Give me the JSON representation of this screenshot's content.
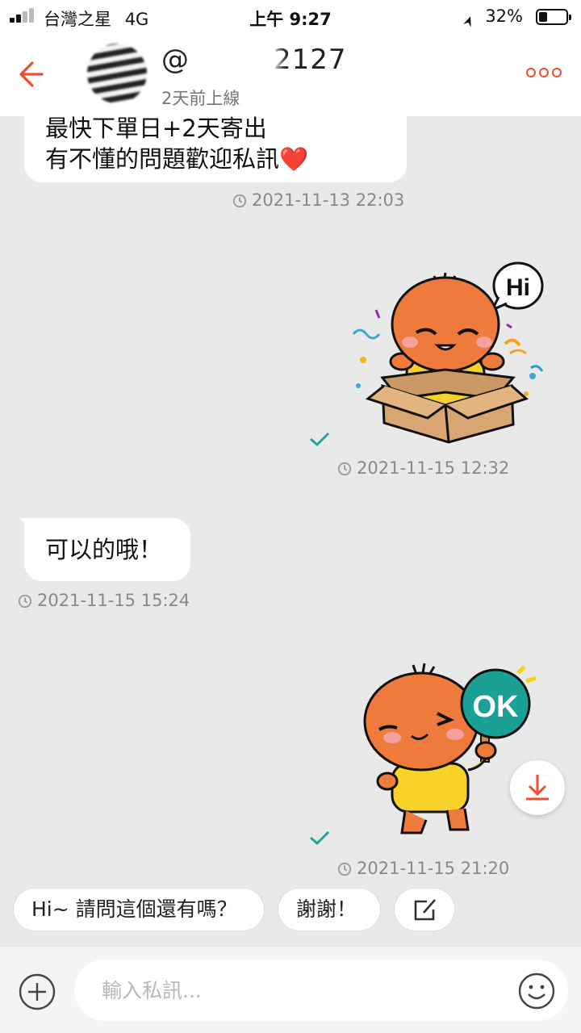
{
  "status_bar": {
    "carrier": "台灣之星",
    "network": "4G",
    "time": "上午 9:27",
    "battery": "32%",
    "location_icon": "location-arrow-icon"
  },
  "header": {
    "username": "@",
    "username_tail": "2127",
    "last_seen": "2天前上線",
    "back_icon": "back-arrow-icon",
    "more_icon": "more-dots-icon",
    "accent_color": "#ee4d2d"
  },
  "messages": [
    {
      "side": "incoming",
      "lines": [
        "最快下單日+2天寄出",
        "有不懂的問題歡迎私訊❤️"
      ],
      "timestamp": "2021-11-13 22:03"
    },
    {
      "side": "outgoing",
      "type": "sticker",
      "sticker": "Hi",
      "timestamp": "2021-11-15 12:32",
      "read": true
    },
    {
      "side": "incoming",
      "text": "可以的哦！",
      "timestamp": "2021-11-15 15:24"
    },
    {
      "side": "outgoing",
      "type": "sticker",
      "sticker": "OK",
      "timestamp": "2021-11-15 21:20",
      "read": true
    }
  ],
  "quick_replies": [
    "Hi~ 請問這個還有嗎？",
    "謝謝！"
  ],
  "quick_edit_icon": "edit-icon",
  "download_icon": "download-icon",
  "input": {
    "placeholder": "輸入私訊...",
    "value": ""
  }
}
